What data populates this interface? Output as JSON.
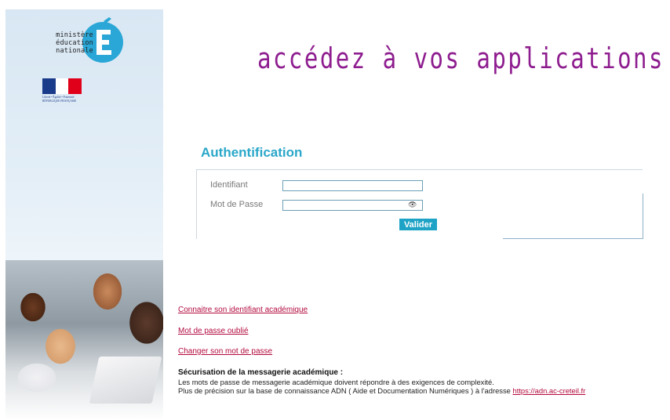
{
  "logo": {
    "lines": [
      "ministère",
      "éducation",
      "nationale"
    ],
    "letter": "É",
    "republic_motto": "Liberté • Égalité • Fraternité",
    "republic_name": "RÉPUBLIQUE FRANÇAISE"
  },
  "header": {
    "title": "accédez à vos applications"
  },
  "auth": {
    "title": "Authentification",
    "identifier_label": "Identifiant",
    "identifier_value": "",
    "password_label": "Mot de Passe",
    "password_value": "",
    "submit_label": "Valider"
  },
  "links": {
    "know_id": "Connaitre son identifiant académique",
    "forgot_password": "Mot de passe oublié",
    "change_password": "Changer son mot de passe"
  },
  "security": {
    "title": "Sécurisation de la messagerie académique :",
    "line1": "Les mots de passe de messagerie académique doivent répondre à des exigences de complexité.",
    "line2_prefix": "Plus de précision sur la base de connaissance ADN ( Aide et Documentation Numériques ) à l'adresse ",
    "line2_link": "https://adn.ac-creteil.fr"
  },
  "colors": {
    "title": "#8e1d8f",
    "auth_title": "#2aa7c9",
    "link": "#b30a3f",
    "button": "#1ea3c6"
  },
  "icons": [
    "logo-e-icon",
    "french-flag-icon",
    "eye-icon"
  ]
}
